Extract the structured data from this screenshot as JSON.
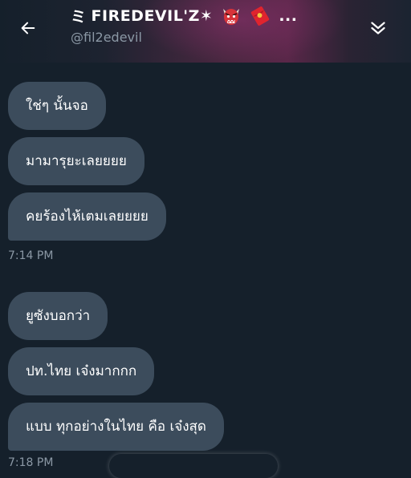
{
  "header": {
    "title_prefix": "ミ",
    "title_text": "FIREDEVIL'Z",
    "title_suffix": "✶",
    "title_more": "...",
    "handle": "@fil2edevil",
    "emojis": [
      "ogre-icon",
      "red-envelope-icon"
    ]
  },
  "messages": [
    {
      "text": "ใช่ๆ นั้นจอ"
    },
    {
      "text": "มามารุยะเลยยยย"
    },
    {
      "text": "คยร้องไห้เตมเลยยยย"
    },
    {
      "text": "ยูซังบอกว่า"
    },
    {
      "text": "ปท.ไทย เจ๋งมากกก"
    },
    {
      "text": "แบบ ทุกอย่างในไทย คือ เจ๋งสุด"
    }
  ],
  "timestamps": [
    "7:14 PM",
    "7:18 PM"
  ],
  "colors": {
    "background": "#15202b",
    "bubble": "#3c4c5c",
    "muted_text": "#8b98a5"
  }
}
